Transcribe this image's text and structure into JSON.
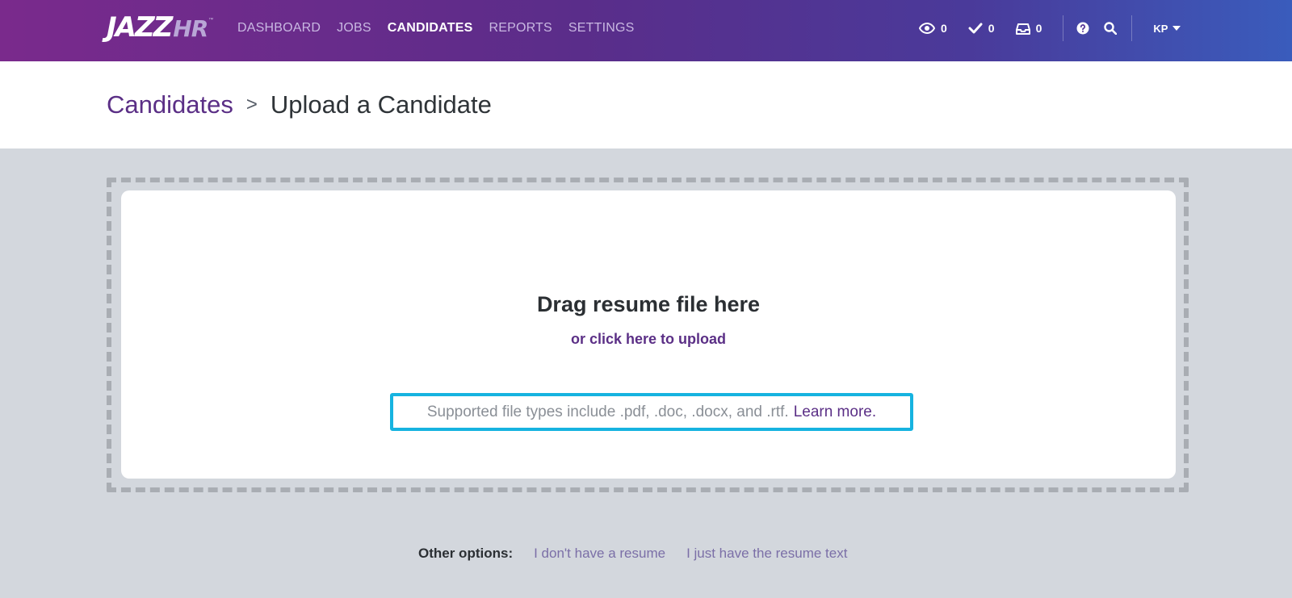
{
  "brand": {
    "logo_main": "JAZZ",
    "logo_accent": "HR",
    "logo_tm": "™"
  },
  "nav": {
    "items": [
      {
        "label": "DASHBOARD",
        "active": false
      },
      {
        "label": "JOBS",
        "active": false
      },
      {
        "label": "CANDIDATES",
        "active": true
      },
      {
        "label": "REPORTS",
        "active": false
      },
      {
        "label": "SETTINGS",
        "active": false
      }
    ]
  },
  "toolbar": {
    "watching_count": "0",
    "tasks_count": "0",
    "inbox_count": "0",
    "help_icon": "question-circle-icon",
    "search_icon": "search-icon",
    "user_initials": "KP"
  },
  "header": {
    "breadcrumb_parent": "Candidates",
    "breadcrumb_separator": ">",
    "breadcrumb_current": "Upload a Candidate"
  },
  "upload": {
    "title": "Drag resume file here",
    "click_link": "or click here to upload",
    "supported_text": "Supported file types include .pdf, .doc, .docx, and .rtf.",
    "learn_more": "Learn more."
  },
  "other_options": {
    "label": "Other options:",
    "no_resume": "I don't have a resume",
    "resume_text": "I just have the resume text"
  },
  "colors": {
    "brand_purple": "#5b2f86",
    "highlight_blue": "#16b3e0",
    "background_gray": "#d3d7dd"
  }
}
